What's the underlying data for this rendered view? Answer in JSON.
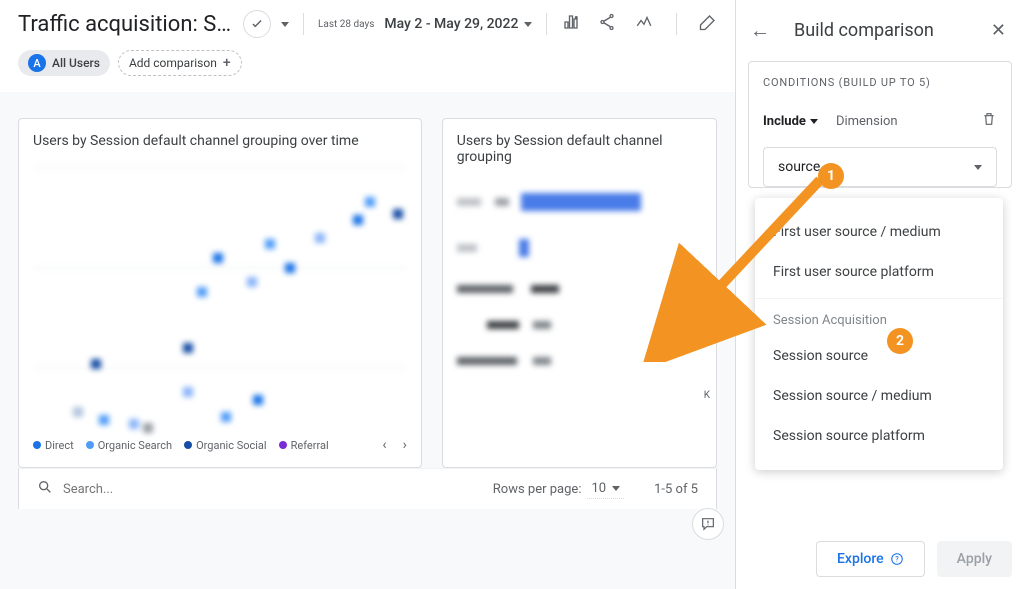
{
  "header": {
    "title": "Traffic acquisition: Ses...",
    "date_label": "Last 28 days",
    "date_range": "May 2 - May 29, 2022"
  },
  "chips": {
    "all_users_letter": "A",
    "all_users_label": "All Users",
    "add_comparison": "Add comparison"
  },
  "card1": {
    "title": "Users by Session default channel grouping over time",
    "legend": {
      "direct": "Direct",
      "organic_search": "Organic Search",
      "organic_social": "Organic Social",
      "referral": "Referral"
    }
  },
  "card2": {
    "title": "Users by Session default channel grouping",
    "axis_k": "K"
  },
  "chart_data": {
    "type": "scatter",
    "title": "Users by Session default channel grouping over time",
    "series": [
      {
        "name": "Direct",
        "color": "#1a73e8"
      },
      {
        "name": "Organic Search",
        "color": "#4f9cf8"
      },
      {
        "name": "Organic Social",
        "color": "#174ea6"
      },
      {
        "name": "Referral",
        "color": "#7b2bd6"
      }
    ]
  },
  "footer": {
    "search_placeholder": "Search...",
    "rpp_label": "Rows per page:",
    "rpp_value": "10",
    "range": "1-5 of 5"
  },
  "sidebar": {
    "title": "Build comparison",
    "conditions_label": "CONDITIONS (BUILD UP TO 5)",
    "include": "Include",
    "dimension": "Dimension",
    "search_value": "source",
    "options": {
      "o1": "First user source / medium",
      "o2": "First user source platform",
      "group": "Session Acquisition",
      "o3": "Session source",
      "o4": "Session source / medium",
      "o5": "Session source platform"
    },
    "explore": "Explore",
    "apply": "Apply"
  },
  "annotations": {
    "one": "1",
    "two": "2"
  }
}
